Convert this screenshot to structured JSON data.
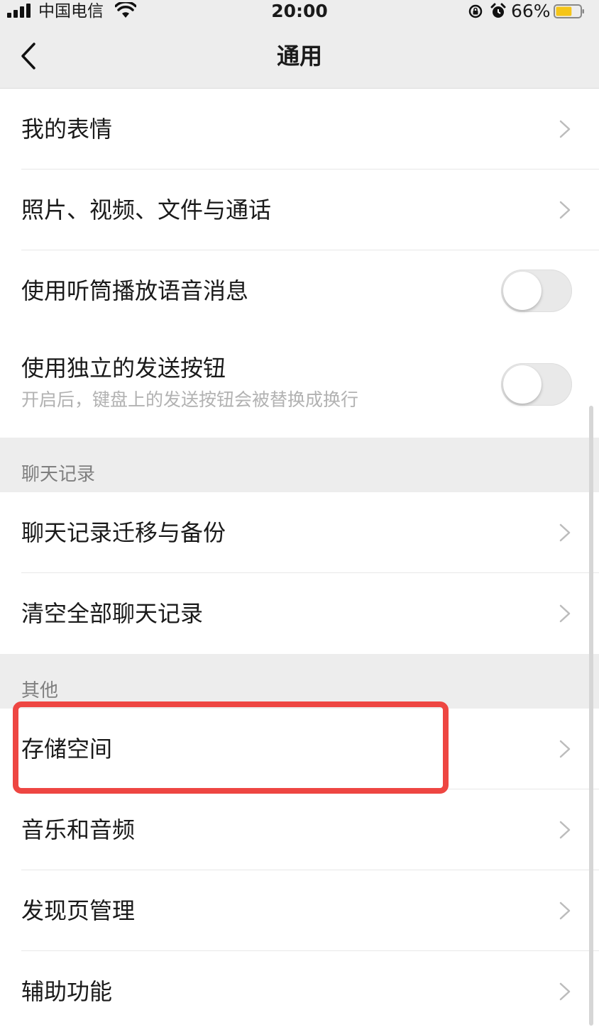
{
  "status_bar": {
    "carrier": "中国电信",
    "time": "20:00",
    "battery": "66%",
    "battery_color": "#f5c518"
  },
  "nav": {
    "title": "通用",
    "back_icon": "chevron-left-icon"
  },
  "group1": [
    {
      "label": "我的表情",
      "control": "chevron"
    },
    {
      "label": "照片、视频、文件与通话",
      "control": "chevron"
    },
    {
      "label": "使用听筒播放语音消息",
      "control": "toggle",
      "value": false
    },
    {
      "label": "使用独立的发送按钮",
      "sublabel": "开启后，键盘上的发送按钮会被替换成换行",
      "control": "toggle",
      "value": false
    }
  ],
  "section_chat": {
    "header": "聊天记录",
    "items": [
      {
        "label": "聊天记录迁移与备份"
      },
      {
        "label": "清空全部聊天记录"
      }
    ]
  },
  "section_other": {
    "header": "其他",
    "items": [
      {
        "label": "存储空间",
        "highlighted": true
      },
      {
        "label": "音乐和音频"
      },
      {
        "label": "发现页管理"
      },
      {
        "label": "辅助功能"
      }
    ]
  },
  "highlight_color": "#ee4642"
}
